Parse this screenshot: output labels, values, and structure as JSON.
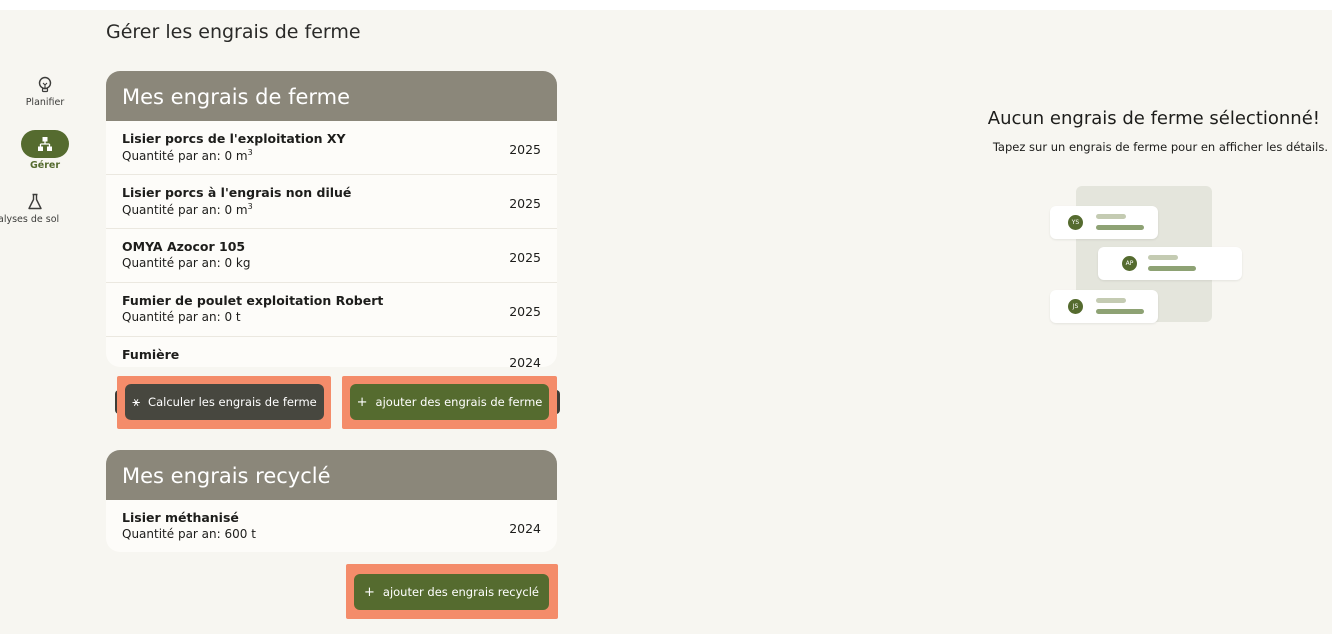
{
  "sidebar": {
    "items": [
      {
        "label": "Planifier",
        "icon": "lightbulb-icon"
      },
      {
        "label": "Gérer",
        "icon": "sitemap-icon",
        "active": true
      },
      {
        "label": "nalyses de sol",
        "icon": "flask-icon"
      }
    ]
  },
  "page": {
    "title": "Gérer les engrais de ferme"
  },
  "farm_card": {
    "title": "Mes engrais de ferme",
    "rows": [
      {
        "name": "Lisier porcs de l'exploitation XY",
        "qty": "Quantité par an: 0 m",
        "sup": "3",
        "year": "2025"
      },
      {
        "name": "Lisier porcs à l'engrais non dilué",
        "qty": "Quantité par an: 0 m",
        "sup": "3",
        "year": "2025"
      },
      {
        "name": "OMYA Azocor 105",
        "qty": "Quantité par an: 0 kg",
        "sup": "",
        "year": "2025"
      },
      {
        "name": "Fumier de poulet exploitation Robert",
        "qty": "Quantité par an: 0 t",
        "sup": "",
        "year": "2025"
      },
      {
        "name": "Fumière",
        "qty": "",
        "sup": "",
        "year": "2024"
      }
    ]
  },
  "buttons": {
    "calculate": "Calculer les engrais de ferme",
    "add_farm": "ajouter des engrais de ferme",
    "add_recycled": "ajouter des engrais recyclé",
    "plus": "+"
  },
  "recycled_card": {
    "title": "Mes engrais recyclé",
    "rows": [
      {
        "name": "Lisier méthanisé",
        "qty": "Quantité par an: 600 t",
        "year": "2024"
      }
    ]
  },
  "empty_state": {
    "title": "Aucun engrais de ferme sélectionné!",
    "subtitle": "Tapez sur un engrais de ferme pour en afficher les détails.",
    "avatars": [
      "YS",
      "AP",
      "JS"
    ]
  },
  "colors": {
    "accent": "#556b2f",
    "header": "#8b877a",
    "highlight": "#f48c6a",
    "background": "#f7f6f1"
  }
}
